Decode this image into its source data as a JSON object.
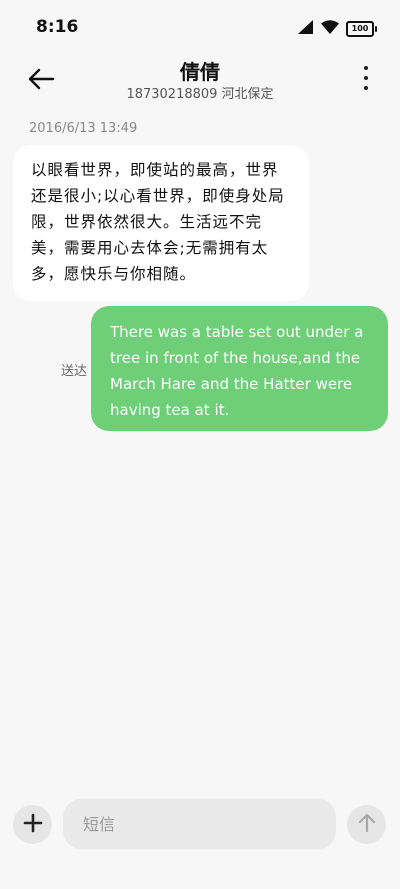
{
  "status_bar": {
    "time": "8:16",
    "battery_level": "100",
    "icons": [
      "signal-icon",
      "wifi-icon",
      "battery-icon"
    ]
  },
  "header": {
    "contact_name": "倩倩",
    "contact_subtitle": "18730218809 河北保定",
    "back_icon": "back-arrow-icon",
    "more_icon": "more-vertical-icon"
  },
  "conversation": {
    "date_stamp": "2016/6/13 13:49",
    "messages": [
      {
        "direction": "incoming",
        "text": "以眼看世界，即使站的最高，世界还是很小;以心看世界，即使身处局限，世界依然很大。生活远不完美，需要用心去体会;无需拥有太多，愿快乐与你相随。"
      },
      {
        "direction": "outgoing",
        "text": "There was a table set out under a tree in front of the house,and the March Hare and the Hatter were having tea at it.",
        "status": "送达"
      }
    ]
  },
  "composer": {
    "placeholder": "短信",
    "value": "",
    "add_icon": "plus-icon",
    "send_icon": "arrow-up-icon"
  },
  "colors": {
    "background": "#f7f7f7",
    "incoming_bubble": "#ffffff",
    "outgoing_bubble": "#6ecf78",
    "input_bg": "#e9e9e9"
  }
}
